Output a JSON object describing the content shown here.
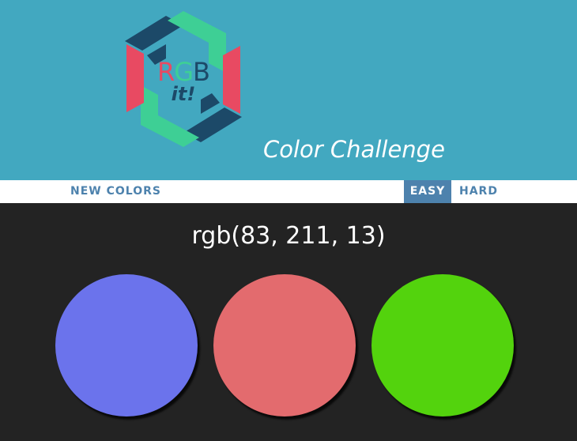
{
  "header": {
    "logo": {
      "letters": [
        "R",
        "G",
        "B"
      ],
      "suffix": "it!"
    },
    "subtitle": "Color Challenge",
    "colors": {
      "background": "#42a8c0",
      "logo_green": "#3ecf95",
      "logo_red": "#e84a62",
      "logo_navy": "#1c4968"
    }
  },
  "nav": {
    "new_colors": "NEW COLORS",
    "modes": [
      "EASY",
      "HARD"
    ],
    "selected_mode": "EASY",
    "accent_color": "#4d82ad"
  },
  "game": {
    "target_label": "rgb(83, 211, 13)",
    "squares": [
      {
        "color": "#6b73ec"
      },
      {
        "color": "#e36b6e"
      },
      {
        "color": "#53d30d"
      }
    ]
  },
  "colors": {
    "page_background": "#232323"
  }
}
